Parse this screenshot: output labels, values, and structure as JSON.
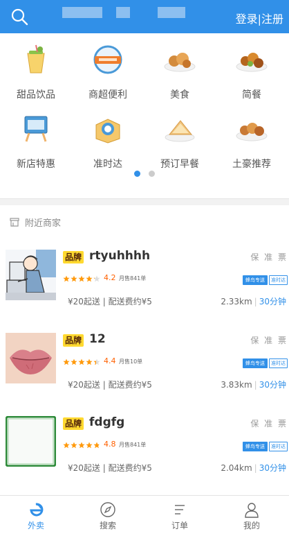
{
  "header": {
    "right_text": "登录|注册",
    "search_icon": "search-icon",
    "brand_color": "#3190e8"
  },
  "categories": [
    {
      "label": "甜品饮品",
      "icon": "drink-icon"
    },
    {
      "label": "商超便利",
      "icon": "supermarket-badge-icon"
    },
    {
      "label": "美食",
      "icon": "food-plate-icon"
    },
    {
      "label": "简餐",
      "icon": "meal-plate-icon"
    },
    {
      "label": "新店特惠",
      "icon": "new-shop-sign-icon"
    },
    {
      "label": "准时达",
      "icon": "on-time-box-icon"
    },
    {
      "label": "预订早餐",
      "icon": "breakfast-sandwich-icon"
    },
    {
      "label": "土豪推荐",
      "icon": "dish-icon"
    }
  ],
  "carousel": {
    "pages": 2,
    "active": 1
  },
  "nearby": {
    "title": "附近商家",
    "icon": "shop-icon"
  },
  "shops": [
    {
      "brand": "品牌",
      "name": "rtyuhhhh",
      "guarantee": "保 准 票",
      "rating": 4.2,
      "score": "4.2",
      "sales": "月售841单",
      "tag_delivery": "蜂鸟专送",
      "tag_ontime": "准时达",
      "fees": "¥20起送 | 配送费约¥5",
      "distance": "2.33km",
      "time": "30分钟",
      "image": "cartoon-computer-user"
    },
    {
      "brand": "品牌",
      "name": "12",
      "guarantee": "保 准 票",
      "rating": 4.4,
      "score": "4.4",
      "sales": "月售10单",
      "tag_delivery": "蜂鸟专送",
      "tag_ontime": "准时达",
      "fees": "¥20起送 | 配送费约¥5",
      "distance": "3.83km",
      "time": "30分钟",
      "image": "lips-photo"
    },
    {
      "brand": "品牌",
      "name": "fdgfg",
      "guarantee": "保 准 票",
      "rating": 4.8,
      "score": "4.8",
      "sales": "月售841单",
      "tag_delivery": "蜂鸟专送",
      "tag_ontime": "准时达",
      "fees": "¥20起送 | 配送费约¥5",
      "distance": "2.04km",
      "time": "30分钟",
      "image": "green-frame"
    }
  ],
  "tabs": [
    {
      "label": "外卖",
      "icon": "takeaway-e-icon",
      "active": true
    },
    {
      "label": "搜索",
      "icon": "compass-icon",
      "active": false
    },
    {
      "label": "订单",
      "icon": "order-list-icon",
      "active": false
    },
    {
      "label": "我的",
      "icon": "user-profile-icon",
      "active": false
    }
  ]
}
